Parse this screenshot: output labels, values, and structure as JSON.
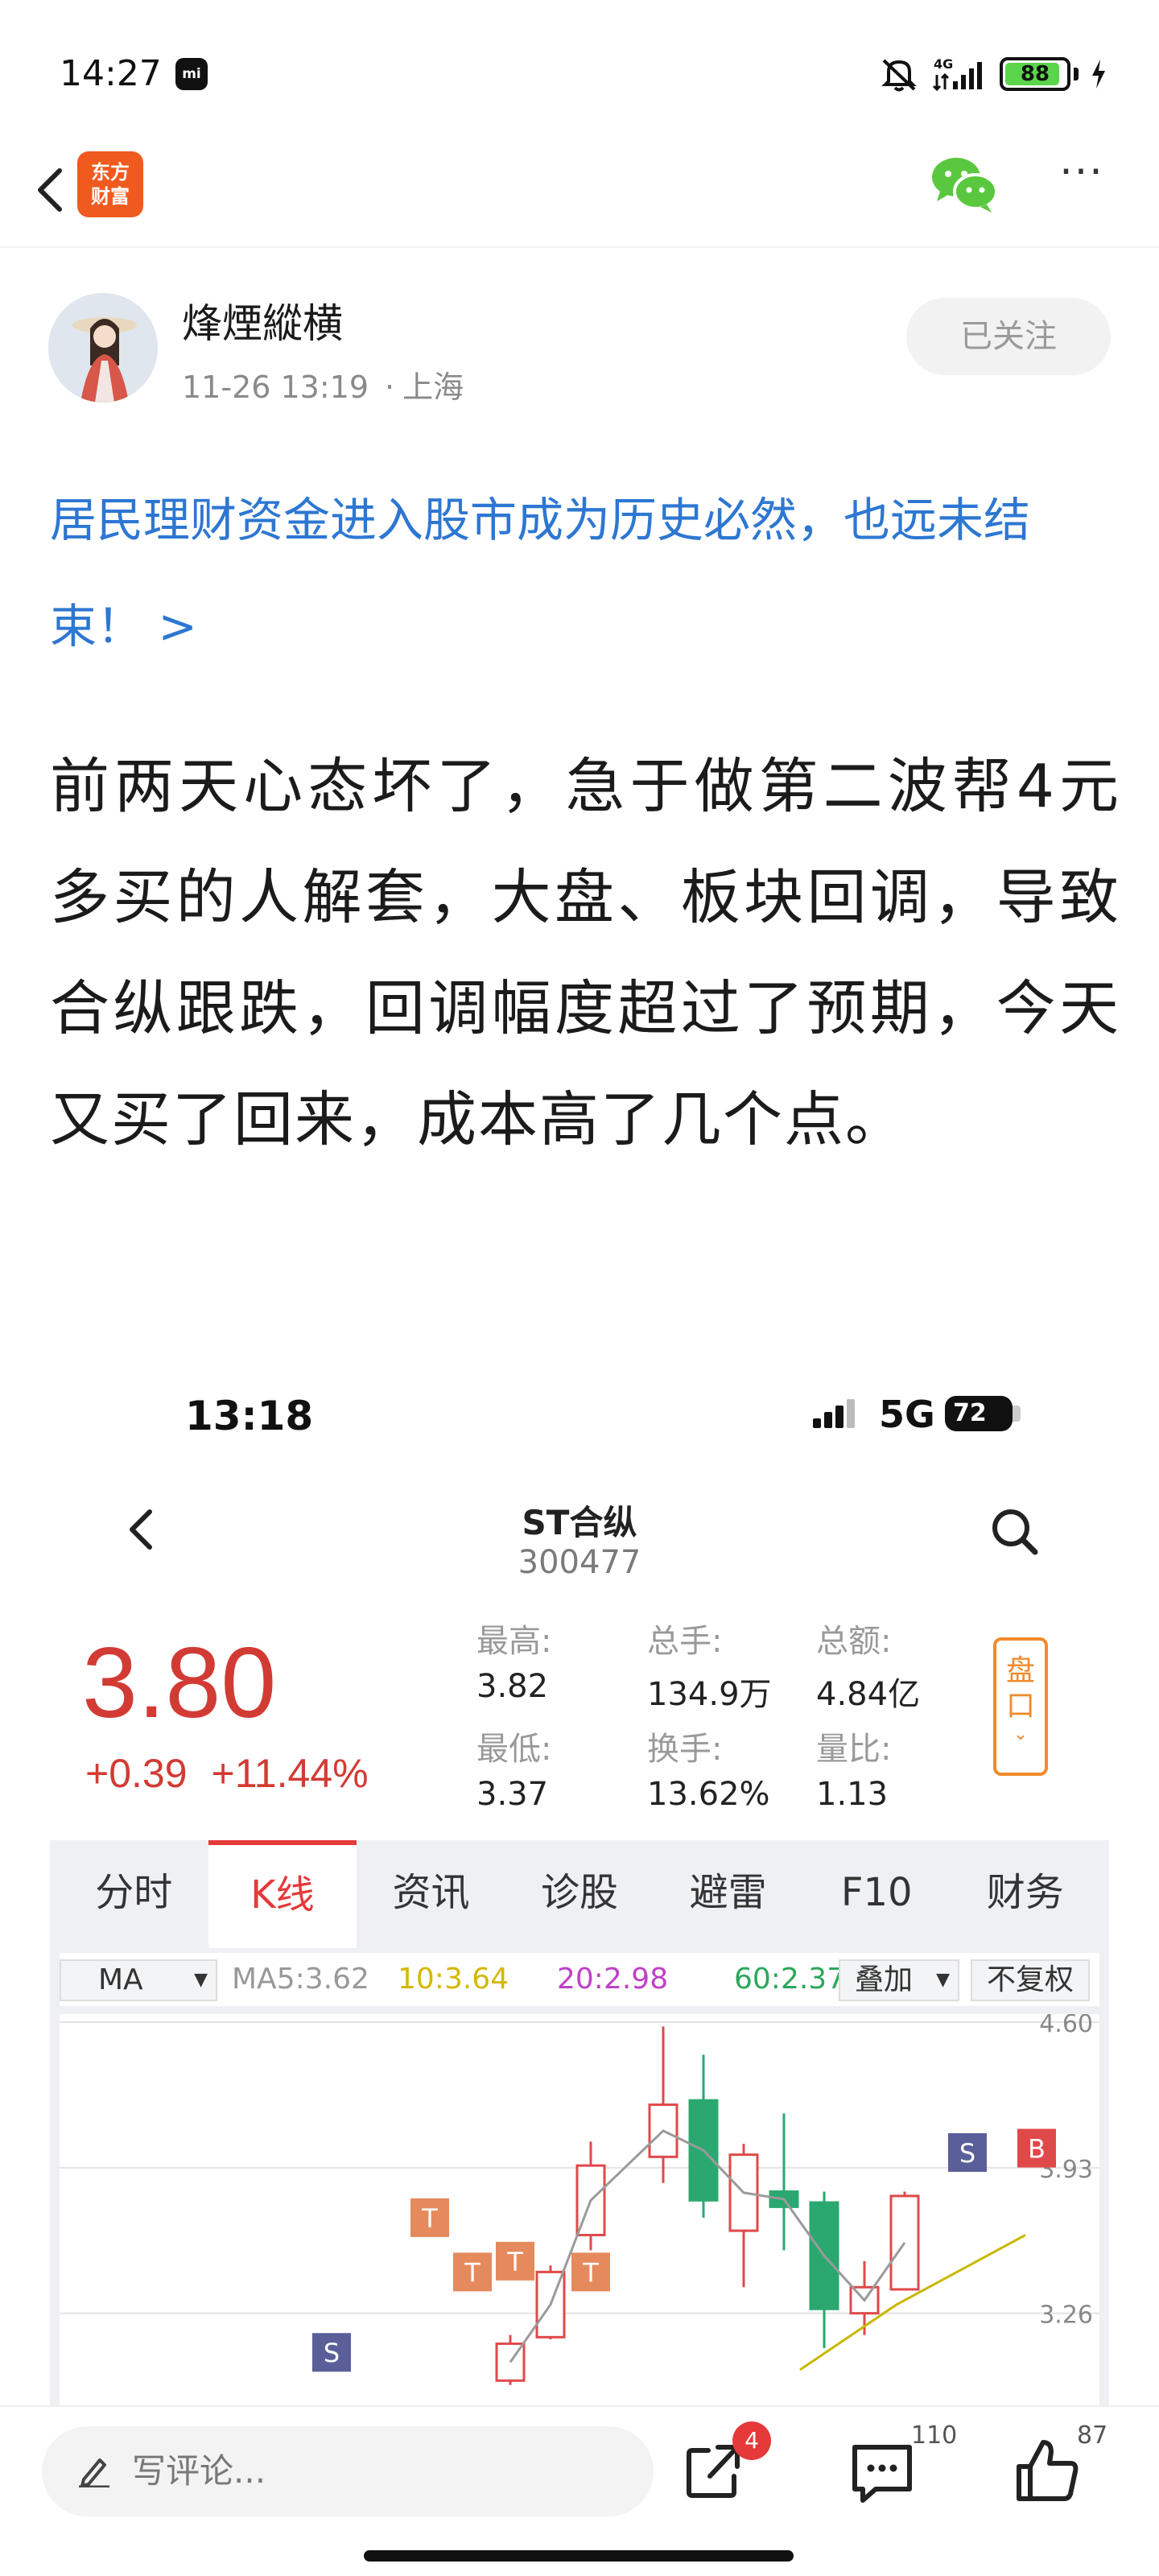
{
  "status_bar": {
    "time": "14:27",
    "network": "4G",
    "battery": 88,
    "battery_label": "88"
  },
  "nav": {
    "app_logo_line1": "东方",
    "app_logo_line2": "财富",
    "more_label": "···"
  },
  "author": {
    "name": "烽煙縱横",
    "date": "11-26 13:19",
    "location": "上海",
    "follow_label": "已关注"
  },
  "topic_link": "居民理财资金进入股市成为历史必然，也远未结束！ >",
  "post_body": "前两天心态坏了，急于做第二波帮4元多买的人解套，大盘、板块回调，导致合纵跟跌，回调幅度超过了预期，今天又买了回来，成本高了几个点。",
  "screenshot": {
    "time": "13:18",
    "network": "5G",
    "battery": "72",
    "stock_name": "ST合纵",
    "stock_code": "300477",
    "price": "3.80",
    "change": "+0.39",
    "change_pct": "+11.44%",
    "stats": {
      "high_label": "最高:",
      "high": "3.82",
      "volume_label": "总手:",
      "volume": "134.9万",
      "amount_label": "总额:",
      "amount": "4.84亿",
      "low_label": "最低:",
      "low": "3.37",
      "turnover_label": "换手:",
      "turnover": "13.62%",
      "ratio_label": "量比:",
      "ratio": "1.13"
    },
    "pankou_label": "盘口",
    "tabs": [
      "分时",
      "K线",
      "资讯",
      "诊股",
      "避雷",
      "F10",
      "财务"
    ],
    "active_tab": 1,
    "ma_select": "MA",
    "ma_values": [
      {
        "label": "MA5:",
        "value": "3.62",
        "color": "#999999"
      },
      {
        "label": "10:",
        "value": "3.64",
        "color": "#d4b800"
      },
      {
        "label": "20:",
        "value": "2.98",
        "color": "#c040c8"
      },
      {
        "label": "60:",
        "value": "2.37",
        "color": "#2aa85a"
      }
    ],
    "overlay_label": "叠加",
    "adjust_label": "不复权",
    "axis_labels": [
      "4.60",
      "3.93",
      "3.26"
    ],
    "markers": {
      "sell": "S",
      "buy": "B",
      "t": "T"
    }
  },
  "chart_data": {
    "type": "candlestick",
    "title": "",
    "y_ticks": [
      "4.60",
      "3.93",
      "3.26"
    ],
    "ylim": [
      2.9,
      4.6
    ],
    "ma": {
      "MA5": 3.62,
      "MA10": 3.64,
      "MA20": 2.98,
      "MA60": 2.37
    },
    "candles": [
      {
        "open": 2.95,
        "close": 3.12,
        "high": 3.16,
        "low": 2.93
      },
      {
        "open": 3.15,
        "close": 3.45,
        "high": 3.48,
        "low": 3.14
      },
      {
        "open": 3.62,
        "close": 3.94,
        "high": 4.05,
        "low": 3.55
      },
      {
        "open": 3.98,
        "close": 4.22,
        "high": 4.58,
        "low": 3.86
      },
      {
        "open": 4.24,
        "close": 3.78,
        "high": 4.45,
        "low": 3.7
      },
      {
        "open": 3.64,
        "close": 3.99,
        "high": 4.04,
        "low": 3.38
      },
      {
        "open": 3.82,
        "close": 3.75,
        "high": 4.18,
        "low": 3.55
      },
      {
        "open": 3.77,
        "close": 3.28,
        "high": 3.82,
        "low": 3.1
      },
      {
        "open": 3.26,
        "close": 3.38,
        "high": 3.5,
        "low": 3.16
      },
      {
        "open": 3.37,
        "close": 3.8,
        "high": 3.82,
        "low": 3.37
      }
    ]
  },
  "bottom_bar": {
    "comment_placeholder": "写评论...",
    "share_badge": "4",
    "comment_count": "110",
    "like_count": "87"
  }
}
